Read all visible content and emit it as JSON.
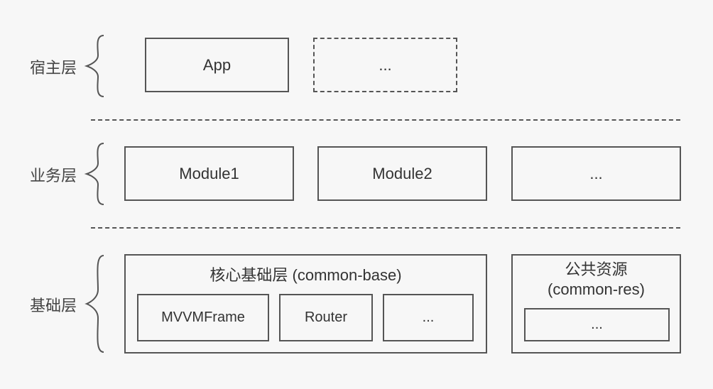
{
  "layers": {
    "host": {
      "label": "宿主层"
    },
    "business": {
      "label": "业务层"
    },
    "base": {
      "label": "基础层"
    }
  },
  "host_boxes": {
    "app": "App",
    "placeholder": "..."
  },
  "business_boxes": {
    "module1": "Module1",
    "module2": "Module2",
    "placeholder": "..."
  },
  "base_core": {
    "title": "核心基础层 (common-base)",
    "items": {
      "mvvm": "MVVMFrame",
      "router": "Router",
      "placeholder": "..."
    }
  },
  "base_res": {
    "title_line1": "公共资源",
    "title_line2": "(common-res)",
    "placeholder": "..."
  }
}
